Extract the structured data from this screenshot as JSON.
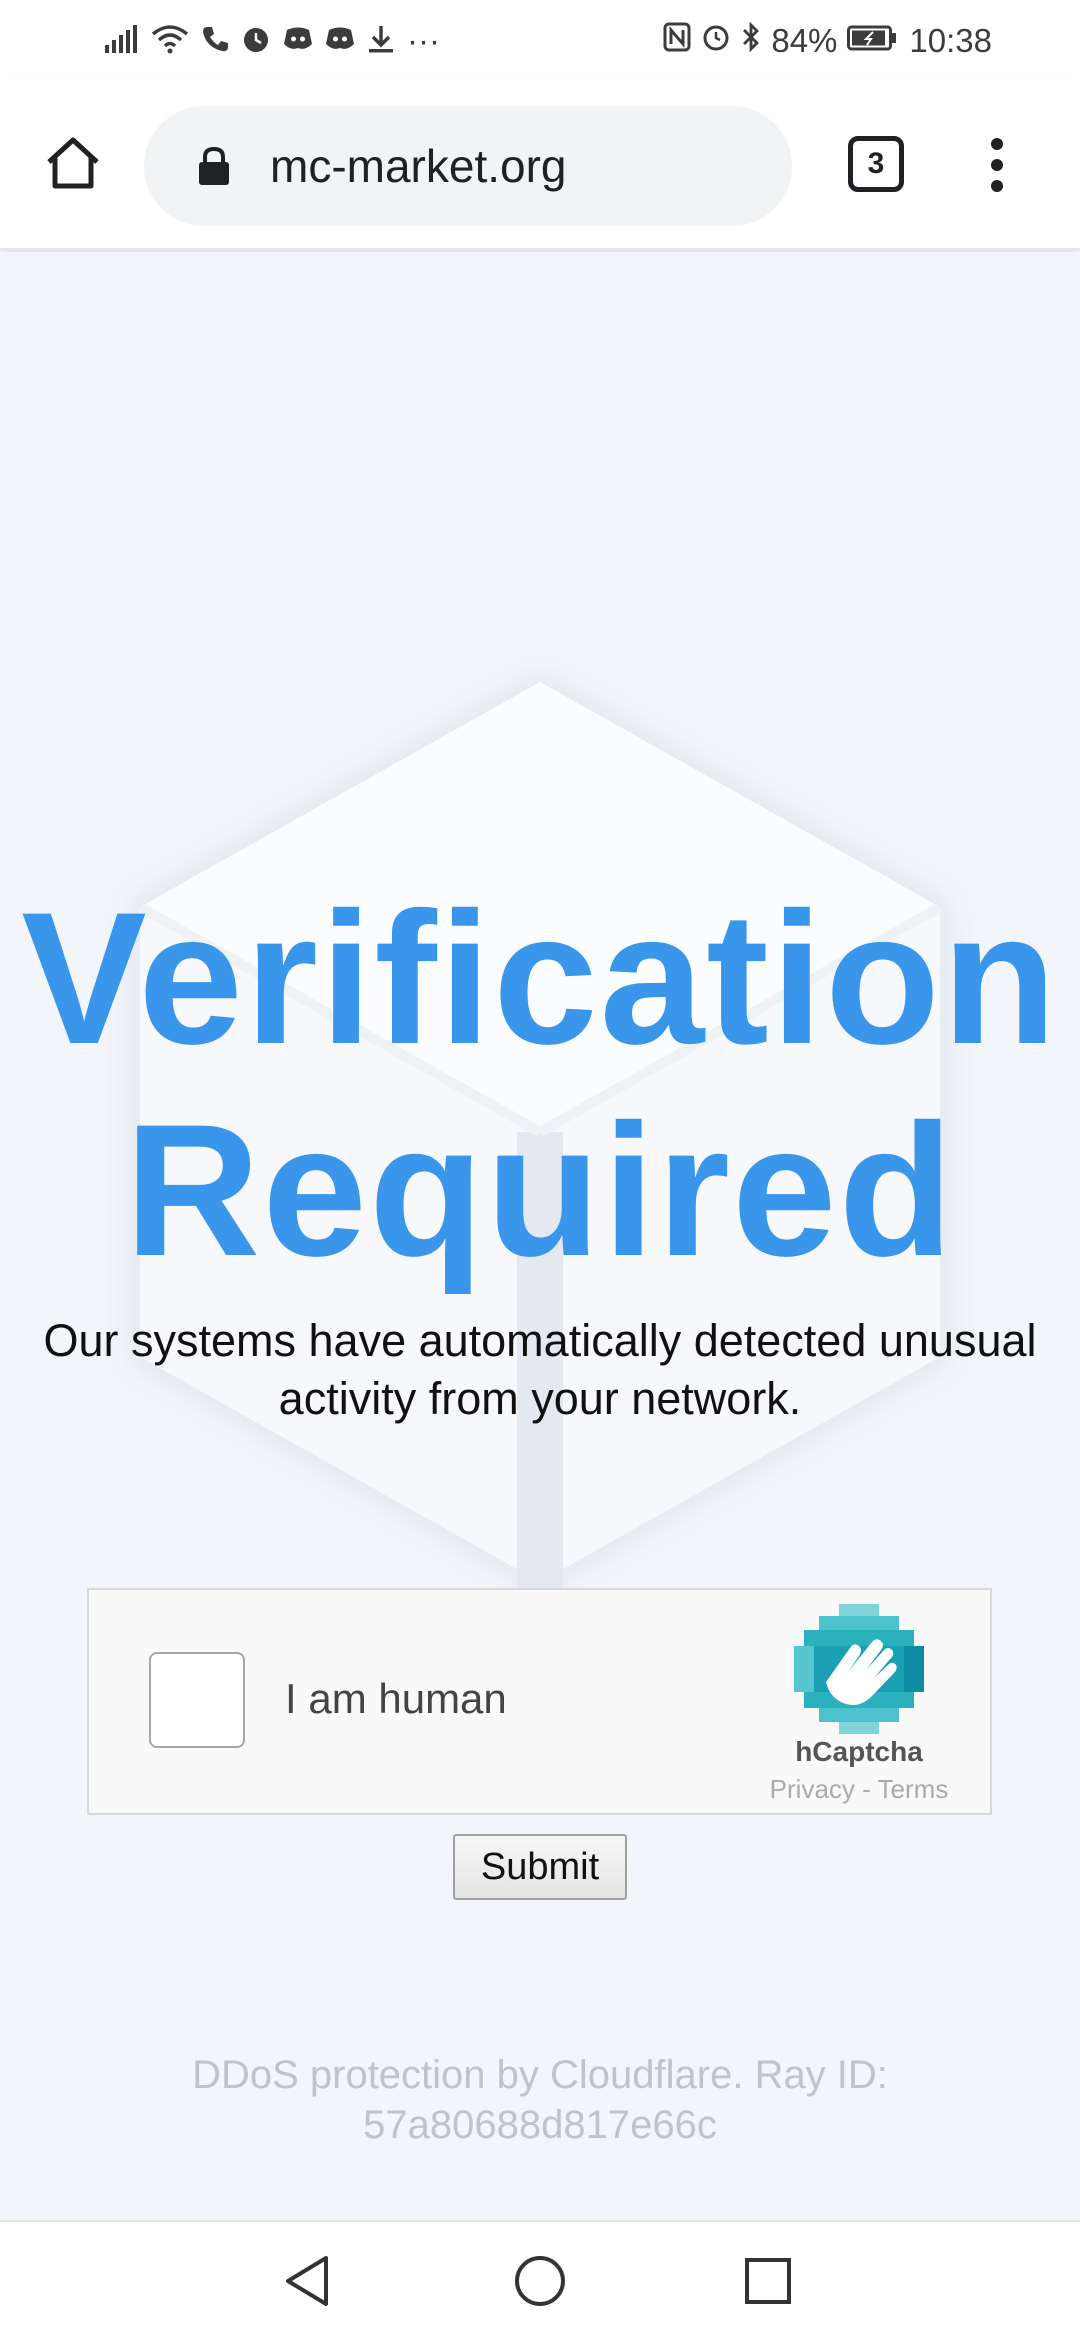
{
  "status_bar": {
    "battery": "84%",
    "time": "10:38",
    "overflow": "···"
  },
  "browser": {
    "url": "mc-market.org",
    "tab_count": "3"
  },
  "page": {
    "headline_line1": "Verification",
    "headline_line2": "Required",
    "message_line1": "Our systems have automatically detected unusual",
    "message_line2": "activity from your network.",
    "captcha": {
      "label": "I am human",
      "brand": "hCaptcha",
      "links": "Privacy - Terms"
    },
    "submit_label": "Submit",
    "footer_line1": "DDoS protection by Cloudflare. Ray ID:",
    "footer_line2": "57a80688d817e66c"
  },
  "colors": {
    "headline": "#3a96ea",
    "page_background": "#f2f5f9",
    "footer_text": "#bfc4cb"
  }
}
